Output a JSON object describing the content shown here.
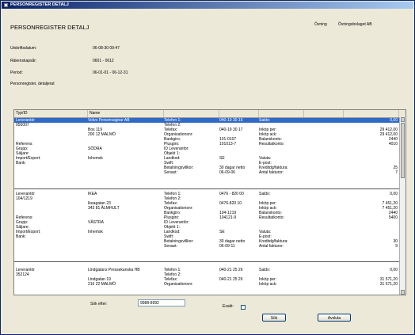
{
  "window": {
    "title": "PERSONREGISTER DETALJ"
  },
  "header": {
    "title": "PERSONREGISTER DETALJ",
    "company_label": "Övning",
    "company": "Övningsbolaget AB",
    "print_date_label": "Utskriftsdatum:",
    "print_date": "06-08-30  09:47",
    "period_label_acc": "Räkenskapsår:",
    "period_acc": "0601 - 0612",
    "period_label": "Period:",
    "period": "06-01-01 - 06-12-31",
    "subtitle": "Personregister, detaljerat"
  },
  "grid": {
    "columns": [
      "Typ/ID",
      "Name"
    ],
    "records": [
      {
        "type": "Leverantör",
        "id": "050007",
        "name": "Volvo Personvagnar AB",
        "address1": "Box 119",
        "address2": "200 12  MALMÖ",
        "ref_label": "Referens:",
        "group_label": "Grupp:",
        "group": "SÖDRA",
        "seller_label": "Säljare:",
        "impexp_label": "Import/Export:",
        "impexp": "Inhemsk",
        "bank_label": "Bank:",
        "tel1_label": "Telefon 1:",
        "tel1": "040-19 30 16",
        "tel2_label": "Telefon 2:",
        "tel2": "",
        "fax_label": "Telefax:",
        "fax": "040-19 30 17",
        "org_label": "Organisationsnr:",
        "org": "",
        "bg_label": "Bankgiro:",
        "bg": "101-0107",
        "pg_label": "Plusgiro:",
        "pg": "101013-7",
        "idlev_label": "ID Leverantör:",
        "idlev": "",
        "obj_label": "Objekt 1:",
        "obj": "",
        "land_label": "Landkod:",
        "land": "SE",
        "swift_label": "Swift:",
        "swift": "",
        "terms_label": "Betalningsvillkor:",
        "terms": "30 dagar netto",
        "last_label": "Senast:",
        "last": "06-09-06",
        "saldo_label": "Saldo:",
        "saldo": "0,00",
        "ink_per_label": "Inköp per:",
        "ink_per": "29 412,00",
        "ink_ack_label": "Inköp ack:",
        "ink_ack": "29 412,00",
        "balkonto_label": "Balanskonto:",
        "balkonto": "2440",
        "reskonto_label": "Resultatkonto:",
        "reskonto": "4010",
        "valuta_label": "Valuta:",
        "valuta": "",
        "epost_label": "E-post:",
        "epost": "",
        "kredit_label": "Kreditdg/faktura:",
        "kredit": "25",
        "antal_label": "Antal fakturor:",
        "antal": "7"
      },
      {
        "type": "Leverantör",
        "id": "104/1219",
        "name": "IKEA",
        "address1": "Ikeagatan 23",
        "address2": "343 81  ÄLMHULT",
        "ref_label": "Referens:",
        "group_label": "Grupp:",
        "group": "VÄSTRA",
        "seller_label": "Säljare:",
        "impexp_label": "Import/Export:",
        "impexp": "Inhemsk",
        "bank_label": "Bank:",
        "tel1_label": "Telefon 1:",
        "tel1": "0476 - 820 00",
        "tel2_label": "Telefon 2:",
        "tel2": "",
        "fax_label": "Telefax:",
        "fax": "0476-820 10",
        "org_label": "Organisationsnr:",
        "org": "",
        "bg_label": "Bankgiro:",
        "bg": "104-1219",
        "pg_label": "Plusgiro:",
        "pg": "104121-9",
        "idlev_label": "ID Leverantör:",
        "idlev": "",
        "obj_label": "Objekt 1:",
        "obj": "",
        "land_label": "Landkod:",
        "land": "SE",
        "swift_label": "Swift:",
        "swift": "",
        "terms_label": "Betalningsvillkor:",
        "terms": "30 dagar netto",
        "last_label": "Senast:",
        "last": "06-09-11",
        "saldo_label": "Saldo:",
        "saldo": "0,00",
        "ink_per_label": "Inköp per:",
        "ink_per": "7 451,20",
        "ink_ack_label": "Inköp ack:",
        "ink_ack": "7 451,20",
        "balkonto_label": "Balanskonto:",
        "balkonto": "2440",
        "reskonto_label": "Resultatkonto:",
        "reskonto": "5400",
        "valuta_label": "Valuta:",
        "valuta": "",
        "epost_label": "E-post:",
        "epost": "",
        "kredit_label": "Kreditdg/faktura:",
        "kredit": "30",
        "antal_label": "Antal fakturor:",
        "antal": "9"
      },
      {
        "type": "Leverantör",
        "id": "352124",
        "name": "Lindgatans Pressekanska HB",
        "address1": "Lindgatan 19",
        "address2": "216 22  MALMÖ",
        "tel1_label": "Telefon 1:",
        "tel1": "040-21 25 26",
        "tel2_label": "Telefon 2:",
        "tel2": "",
        "fax_label": "Telefax:",
        "fax": "040-21 25 26",
        "org_label": "Organisationsnr:",
        "org": "",
        "saldo_label": "Saldo:",
        "saldo": "0,00",
        "ink_per_label": "Inköp per:",
        "ink_per": "31 571,20",
        "ink_ack_label": "Inköp ack:",
        "ink_ack": "31 571,20"
      }
    ]
  },
  "search": {
    "label": "Sök efter:",
    "value": "9988-8992"
  },
  "exact": {
    "label": "Exakt:"
  },
  "buttons": {
    "search": "Sök",
    "close": "Avsluta"
  }
}
